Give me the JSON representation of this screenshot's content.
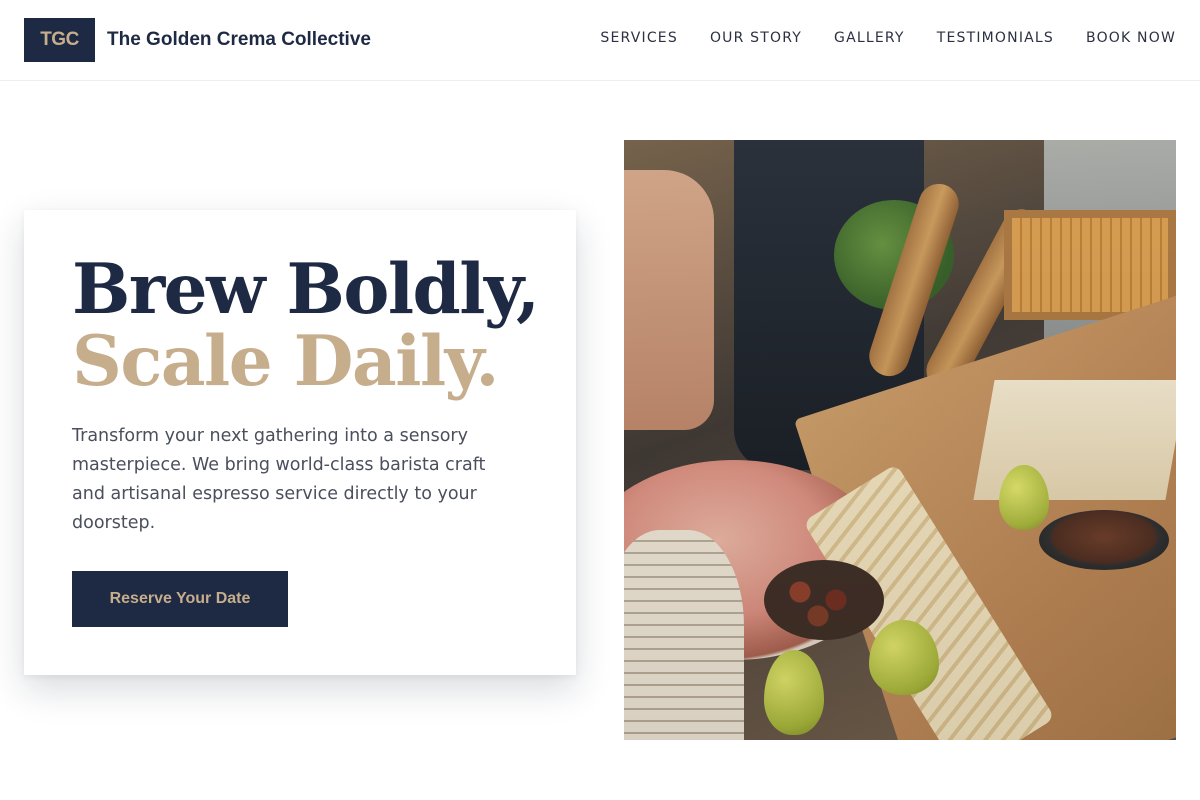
{
  "brand": {
    "logo_text": "TGC",
    "name": "The Golden Crema Collective"
  },
  "nav": {
    "items": [
      {
        "label": "SERVICES"
      },
      {
        "label": "OUR STORY"
      },
      {
        "label": "GALLERY"
      },
      {
        "label": "TESTIMONIALS"
      },
      {
        "label": "BOOK NOW"
      }
    ]
  },
  "hero": {
    "headline_line1": "Brew Boldly,",
    "headline_line2": "Scale Daily.",
    "description": "Transform your next gathering into a sensory masterpiece. We bring world-class barista craft and artisanal espresso service directly to your doorstep.",
    "cta_label": "Reserve Your Date",
    "image_subject": "catering-spread-photo"
  },
  "colors": {
    "navy": "#1e2a44",
    "gold": "#c6ad8c",
    "body_text": "#4a4f5c",
    "background": "#ffffff"
  }
}
